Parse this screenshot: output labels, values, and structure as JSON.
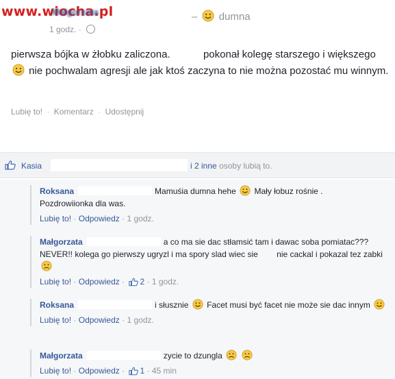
{
  "watermark": "www.wiocha.pl",
  "post": {
    "author": "Małgorzata",
    "feeling_prefix": "–",
    "feeling": "dumna",
    "time": "1 godz.",
    "time_sep": "·",
    "text_part1": "pierwsza bójka w żłobku zaliczona.",
    "text_part2": "pokonał kolegę starszego i większego",
    "text_part3": "nie pochwalam agresji ale jak ktoś zaczyna to nie można pozostać mu winnym.",
    "actions": {
      "like": "Lubię to!",
      "comment": "Komentarz",
      "share": "Udostępnij",
      "sep": "·"
    }
  },
  "likes": {
    "first": "Kasia",
    "rest": "i 2 inne",
    "suffix": "osoby lubią to."
  },
  "comments": [
    {
      "name": "Roksana",
      "text_a": "Mamuśia dumna hehe",
      "text_b": "Mały łobuz rośnie .",
      "text_c": "Pozdrowiionka dla was.",
      "like": "Lubię to!",
      "reply": "Odpowiedz",
      "time": "1 godz.",
      "sep": "·",
      "likes_count": ""
    },
    {
      "name": "Małgorzata",
      "text_a": "a co ma sie dac stłamsić tam i dawac soba pomiatac??? NEVER!! kolega go pierwszy ugryzl i ma spory slad wiec sie",
      "text_b": "nie cackal i pokazal tez zabki",
      "like": "Lubię to!",
      "reply": "Odpowiedz",
      "time": "1 godz.",
      "sep": "·",
      "likes_count": "2"
    },
    {
      "name": "Roksana",
      "text_a": "i słusznie",
      "text_b": "Facet musi być facet nie może sie dac innym",
      "like": "Lubię to!",
      "reply": "Odpowiedz",
      "time": "1 godz.",
      "sep": "·"
    },
    {
      "name": "Małgorzata",
      "text_a": "zycie to dzungla",
      "like": "Lubię to!",
      "reply": "Odpowiedz",
      "time": "45 min",
      "sep": "·",
      "likes_count": "1"
    }
  ],
  "colors": {
    "link": "#365899",
    "grey": "#90949c",
    "watermark": "#d42020",
    "smiley": "#f7c948"
  }
}
